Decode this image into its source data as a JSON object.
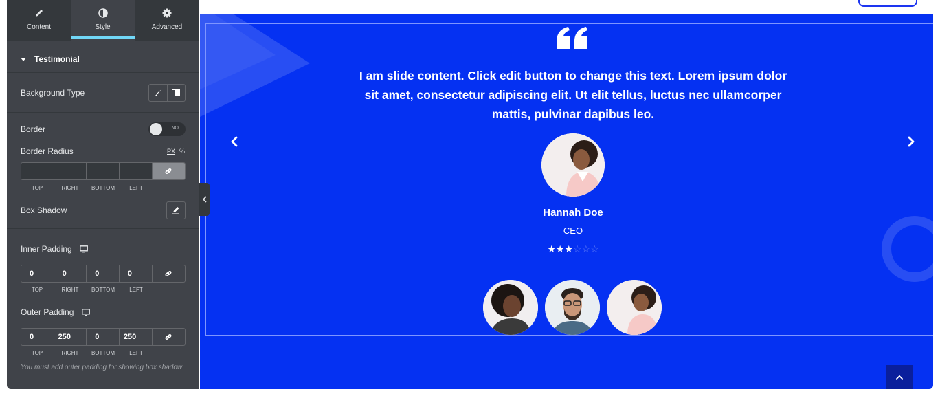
{
  "panel": {
    "tabs": [
      {
        "label": "Content",
        "icon": "pencil-icon"
      },
      {
        "label": "Style",
        "icon": "half-circle-icon"
      },
      {
        "label": "Advanced",
        "icon": "gear-icon"
      }
    ],
    "section_title": "Testimonial",
    "background_type_label": "Background Type",
    "border_label": "Border",
    "border_toggle_text": "NO",
    "border_radius_label": "Border Radius",
    "units": {
      "px": "PX",
      "percent": "%"
    },
    "dim_labels": [
      "TOP",
      "RIGHT",
      "BOTTOM",
      "LEFT"
    ],
    "box_shadow_label": "Box Shadow",
    "inner_padding_label": "Inner Padding",
    "inner_padding": [
      "0",
      "0",
      "0",
      "0"
    ],
    "outer_padding_label": "Outer Padding",
    "outer_padding": [
      "0",
      "250",
      "0",
      "250"
    ],
    "note": "You must add outer padding for showing box shadow"
  },
  "preview": {
    "content": "I am slide content. Click edit button to change this text. Lorem ipsum dolor sit amet, consectetur adipiscing elit. Ut elit tellus, luctus nec ullamcorper mattis, pulvinar dapibus leo.",
    "name": "Hannah Doe",
    "role": "CEO",
    "rating": 3,
    "rating_max": 6,
    "star_on": "★★★",
    "star_off": "☆☆☆"
  },
  "colors": {
    "panel_bg": "#404349",
    "accent": "#71d7f7",
    "slider_bg": "#0531f2"
  }
}
